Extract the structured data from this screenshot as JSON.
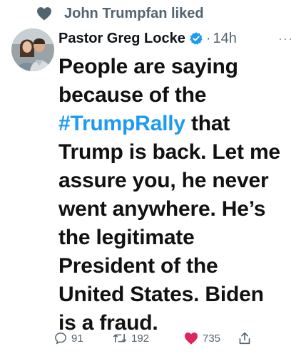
{
  "social_context": {
    "icon": "heart-icon",
    "text": "John Trumpfan liked"
  },
  "author": {
    "name": "Pastor Greg Locke",
    "verified_icon": "verified-badge-icon",
    "separator": "·",
    "time": "14h",
    "more_label": "···"
  },
  "tweet": {
    "text_before": "People are saying because of the ",
    "hashtag": "#TrumpRally",
    "text_after": " that Trump is back. Let me assure you, he never went anywhere. He’s the legitimate President of the United States. Biden is a fraud."
  },
  "actions": {
    "reply_count": "91",
    "retweet_count": "192",
    "like_count": "735"
  },
  "colors": {
    "hashtag": "#1d9bf0",
    "muted": "#536471",
    "like": "#e0245e",
    "verified": "#1d9bf0"
  }
}
